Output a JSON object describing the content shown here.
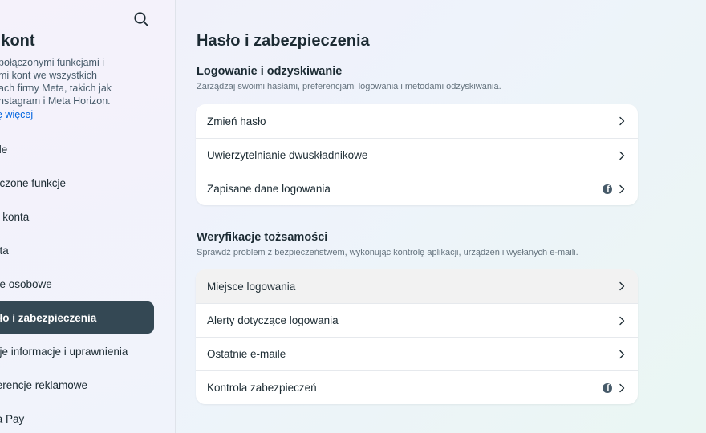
{
  "sidebar": {
    "title": "m kont",
    "description_lines": [
      "połączonymi funkcjami i",
      "mi kont we wszystkich",
      "ach firmy Meta, takich jak",
      "nstagram i Meta Horizon."
    ],
    "learn_more": "ę więcej",
    "items": [
      {
        "label": "file"
      },
      {
        "label": "ączone funkcje"
      },
      {
        "label": "a konta"
      },
      {
        "label": "nta"
      },
      {
        "label": "ne osobowe"
      },
      {
        "label": "sło i zabezpieczenia",
        "active": true
      },
      {
        "label": "oje informacje i uprawnienia"
      },
      {
        "label": "ferencje reklamowe"
      },
      {
        "label": "ta Pay"
      }
    ]
  },
  "main": {
    "title": "Hasło i zabezpieczenia",
    "sections": [
      {
        "title": "Logowanie i odzyskiwanie",
        "subtitle": "Zarządzaj swoimi hasłami, preferencjami logowania i metodami odzyskiwania.",
        "rows": [
          {
            "label": "Zmień hasło",
            "icon": "chevron-right-icon"
          },
          {
            "label": "Uwierzytelnianie dwuskładnikowe",
            "icon": "chevron-right-icon"
          },
          {
            "label": "Zapisane dane logowania",
            "icon": "chevron-right-icon",
            "badge_icon": "facebook-icon"
          }
        ]
      },
      {
        "title": "Weryfikacje tożsamości",
        "subtitle": "Sprawdź problem z bezpieczeństwem, wykonując kontrolę aplikacji, urządzeń i wysłanych e-maili.",
        "rows": [
          {
            "label": "Miejsce logowania",
            "icon": "chevron-right-icon",
            "hovered": true
          },
          {
            "label": "Alerty dotyczące logowania",
            "icon": "chevron-right-icon"
          },
          {
            "label": "Ostatnie e-maile",
            "icon": "chevron-right-icon"
          },
          {
            "label": "Kontrola zabezpieczeń",
            "icon": "chevron-right-icon",
            "badge_icon": "facebook-icon"
          }
        ]
      }
    ]
  },
  "colors": {
    "active_item_bg": "#344854",
    "link": "#0064e0",
    "text": "#1c2b33"
  }
}
